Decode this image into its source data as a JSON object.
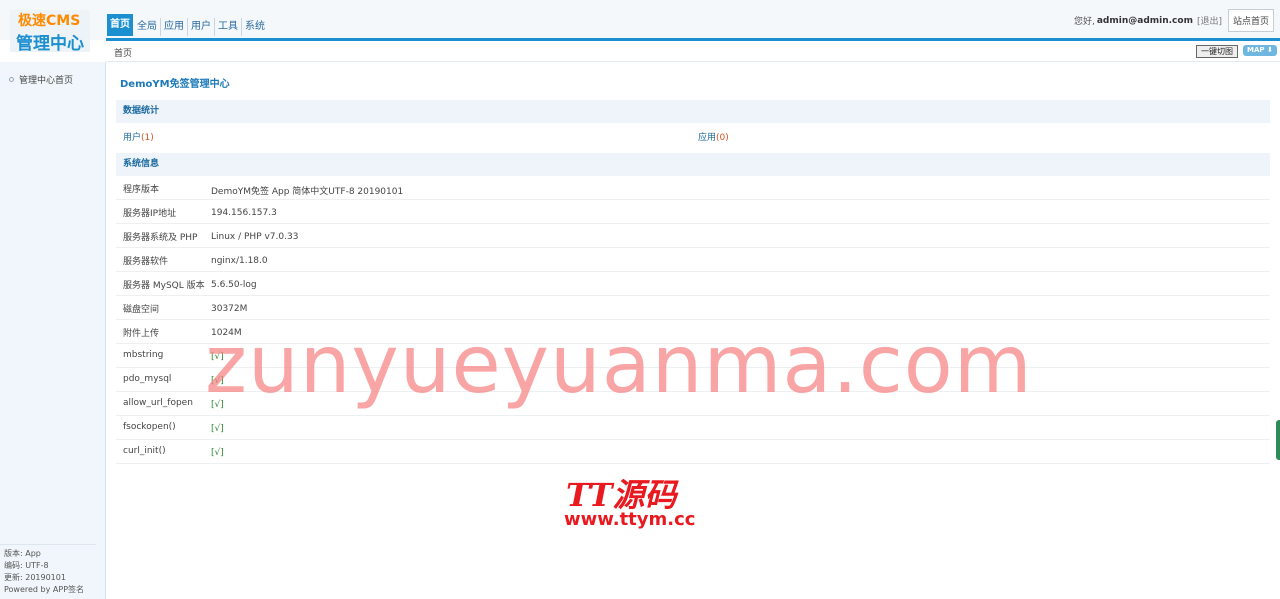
{
  "logo": {
    "line1": "极速CMS",
    "line2": "管理中心"
  },
  "nav": {
    "tabs": [
      {
        "label": "首页",
        "active": true
      },
      {
        "label": "全局",
        "active": false
      },
      {
        "label": "应用",
        "active": false
      },
      {
        "label": "用户",
        "active": false
      },
      {
        "label": "工具",
        "active": false
      },
      {
        "label": "系统",
        "active": false
      }
    ]
  },
  "userbar": {
    "greeting": "您好,",
    "user": "admin@admin.com",
    "logout": "[退出]",
    "site_home": "站点首页"
  },
  "breadcrumb": {
    "home": "首页",
    "cut_button": "一键切图",
    "map_button": "MAP ⬇"
  },
  "sidebar": {
    "menu_item": "管理中心首页",
    "info": [
      "版本: App",
      "编码: UTF-8",
      "更新: 20190101",
      "Powered by APP签名"
    ]
  },
  "main": {
    "title": "DemoYM免签管理中心",
    "stats_section": "数据统计",
    "stats": {
      "user_label": "用户",
      "user_count": "(1)",
      "app_label": "应用",
      "app_count": "(0)"
    },
    "sysinfo_section": "系统信息",
    "rows": [
      {
        "k": "程序版本",
        "v": "DemoYM免签 App 简体中文UTF-8 20190101"
      },
      {
        "k": "服务器IP地址",
        "v": "194.156.157.3"
      },
      {
        "k": "服务器系统及 PHP",
        "v": "Linux / PHP v7.0.33"
      },
      {
        "k": "服务器软件",
        "v": "nginx/1.18.0"
      },
      {
        "k": "服务器 MySQL 版本",
        "v": "5.6.50-log"
      },
      {
        "k": "磁盘空间",
        "v": "30372M"
      },
      {
        "k": "附件上传",
        "v": "1024M"
      },
      {
        "k": "mbstring",
        "v": "[√]"
      },
      {
        "k": "pdo_mysql",
        "v": "[√]"
      },
      {
        "k": "allow_url_fopen",
        "v": "[√]"
      },
      {
        "k": "fsockopen()",
        "v": "[√]"
      },
      {
        "k": "curl_init()",
        "v": "[√]"
      }
    ]
  },
  "watermark": {
    "domain": "zunyueyuanma.com",
    "brand": "TT源码",
    "brand_url": "www.ttym.cc"
  }
}
